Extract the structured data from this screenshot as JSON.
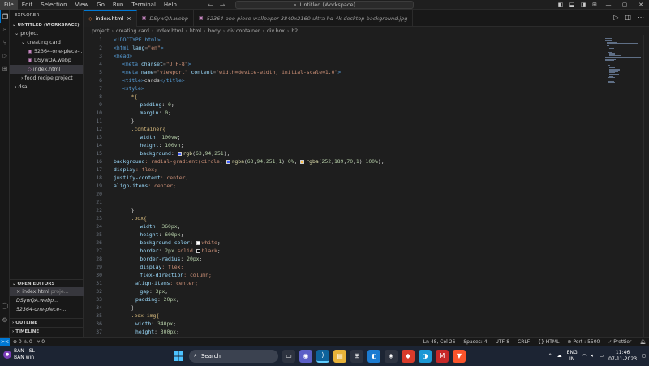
{
  "menu": {
    "items": [
      "File",
      "Edit",
      "Selection",
      "View",
      "Go",
      "Run",
      "Terminal",
      "Help"
    ],
    "active": "File"
  },
  "command_center": {
    "label": "Untitled (Workspace)"
  },
  "explorer": {
    "header": "EXPLORER",
    "workspace": "UNTITLED (WORKSPACE)",
    "tree": [
      {
        "label": "project",
        "arrow": "⌄",
        "indent": 6,
        "selected": false
      },
      {
        "label": "creating card",
        "arrow": "⌄",
        "indent": 14,
        "selected": false
      },
      {
        "label": "52364-one-piece-...",
        "arrow": "",
        "indent": 22,
        "icon": "▣",
        "selected": false
      },
      {
        "label": "DSywQA.webp",
        "arrow": "",
        "indent": 22,
        "icon": "▣",
        "selected": false
      },
      {
        "label": "index.html",
        "arrow": "",
        "indent": 22,
        "icon": "◇",
        "selected": true
      },
      {
        "label": "food recipe project",
        "arrow": "›",
        "indent": 14,
        "selected": false
      },
      {
        "label": "dsa",
        "arrow": "›",
        "indent": 6,
        "selected": false
      }
    ],
    "open_editors_header": "OPEN EDITORS",
    "open_editors": [
      {
        "label": "index.html",
        "desc": "proje...",
        "selected": true,
        "close": "×"
      },
      {
        "label": "DSywQA.webp...",
        "desc": "",
        "selected": false,
        "close": ""
      },
      {
        "label": "52364-one-piece-...",
        "desc": "",
        "selected": false,
        "close": ""
      }
    ],
    "outline": "OUTLINE",
    "timeline": "TIMELINE"
  },
  "tabs": [
    {
      "label": "index.html",
      "icon": "◇",
      "active": true,
      "close": "×"
    },
    {
      "label": "DSywQA.webp",
      "icon": "▣",
      "active": false,
      "close": ""
    },
    {
      "label": "52364-one-piece-wallpaper-3840x2160-ultra-hd-4k-desktop-background.jpg",
      "icon": "▣",
      "active": false,
      "close": ""
    }
  ],
  "breadcrumb": [
    "project",
    "creating card",
    "index.html",
    "html",
    "body",
    "div.container",
    "div.box",
    "h2"
  ],
  "code": {
    "current_line": 48,
    "lines": [
      {
        "n": 1,
        "i": 0,
        "t": [
          [
            "<!DOCTYPE html>",
            "tag"
          ]
        ]
      },
      {
        "n": 2,
        "i": 0,
        "t": [
          [
            "<html ",
            "tag"
          ],
          [
            "lang",
            "attr"
          ],
          [
            "=",
            "punct"
          ],
          [
            "\"en\"",
            "str"
          ],
          [
            ">",
            "tag"
          ]
        ]
      },
      {
        "n": 3,
        "i": 0,
        "t": [
          [
            "<head>",
            "tag"
          ]
        ]
      },
      {
        "n": 4,
        "i": 2,
        "t": [
          [
            "<meta ",
            "tag"
          ],
          [
            "charset",
            "attr"
          ],
          [
            "=",
            "punct"
          ],
          [
            "\"UTF-8\"",
            "str"
          ],
          [
            ">",
            "tag"
          ]
        ]
      },
      {
        "n": 5,
        "i": 2,
        "t": [
          [
            "<meta ",
            "tag"
          ],
          [
            "name",
            "attr"
          ],
          [
            "=",
            "punct"
          ],
          [
            "\"viewport\" ",
            "str"
          ],
          [
            "content",
            "attr"
          ],
          [
            "=",
            "punct"
          ],
          [
            "\"width=device-width, initial-scale=1.0\"",
            "str"
          ],
          [
            ">",
            "tag"
          ]
        ]
      },
      {
        "n": 6,
        "i": 2,
        "t": [
          [
            "<title>",
            "tag"
          ],
          [
            "cards",
            "text"
          ],
          [
            "</title>",
            "tag"
          ]
        ]
      },
      {
        "n": 7,
        "i": 2,
        "t": [
          [
            "<style>",
            "tag"
          ]
        ]
      },
      {
        "n": 8,
        "i": 4,
        "t": [
          [
            "*{",
            "sel"
          ]
        ]
      },
      {
        "n": 9,
        "i": 6,
        "t": [
          [
            "padding",
            "prop"
          ],
          [
            ": ",
            "text"
          ],
          [
            "0",
            "num"
          ],
          [
            ";",
            "text"
          ]
        ]
      },
      {
        "n": 10,
        "i": 6,
        "t": [
          [
            "margin",
            "prop"
          ],
          [
            ": ",
            "text"
          ],
          [
            "0",
            "num"
          ],
          [
            ";",
            "text"
          ]
        ]
      },
      {
        "n": 11,
        "i": 4,
        "t": [
          [
            "}",
            "text"
          ]
        ]
      },
      {
        "n": 12,
        "i": 4,
        "t": [
          [
            ".container{",
            "sel"
          ]
        ]
      },
      {
        "n": 13,
        "i": 6,
        "t": [
          [
            "width",
            "prop"
          ],
          [
            ": ",
            "text"
          ],
          [
            "100vw",
            "num"
          ],
          [
            ";",
            "text"
          ]
        ]
      },
      {
        "n": 14,
        "i": 6,
        "t": [
          [
            "height",
            "prop"
          ],
          [
            ": ",
            "text"
          ],
          [
            "100vh",
            "num"
          ],
          [
            ";",
            "text"
          ]
        ]
      },
      {
        "n": 15,
        "i": 6,
        "t": [
          [
            "background",
            "prop"
          ],
          [
            ": ",
            "text"
          ],
          [
            "SW1",
            "swatch"
          ],
          [
            "rgb",
            "fn"
          ],
          [
            "(",
            "text"
          ],
          [
            "63",
            "num"
          ],
          [
            ",",
            "text"
          ],
          [
            "94",
            "num"
          ],
          [
            ",",
            "text"
          ],
          [
            "251",
            "num"
          ],
          [
            ");",
            "text"
          ]
        ]
      },
      {
        "n": 16,
        "i": 0,
        "t": [
          [
            "background",
            "prop"
          ],
          [
            ": radial-gradient(circle, ",
            "val"
          ],
          [
            "SW1",
            "swatch"
          ],
          [
            "rgba",
            "fn"
          ],
          [
            "(",
            "text"
          ],
          [
            "63",
            "num"
          ],
          [
            ",",
            "text"
          ],
          [
            "94",
            "num"
          ],
          [
            ",",
            "text"
          ],
          [
            "251",
            "num"
          ],
          [
            ",",
            "text"
          ],
          [
            "1",
            "num"
          ],
          [
            ") ",
            "text"
          ],
          [
            "0%",
            "num"
          ],
          [
            ", ",
            "text"
          ],
          [
            "SW2",
            "swatch"
          ],
          [
            "rgba",
            "fn"
          ],
          [
            "(",
            "text"
          ],
          [
            "252",
            "num"
          ],
          [
            ",",
            "text"
          ],
          [
            "189",
            "num"
          ],
          [
            ",",
            "text"
          ],
          [
            "70",
            "num"
          ],
          [
            ",",
            "text"
          ],
          [
            "1",
            "num"
          ],
          [
            ") ",
            "text"
          ],
          [
            "100%",
            "num"
          ],
          [
            ");",
            "text"
          ]
        ]
      },
      {
        "n": 17,
        "i": 0,
        "t": [
          [
            "display",
            "prop"
          ],
          [
            ": flex;",
            "val"
          ]
        ]
      },
      {
        "n": 18,
        "i": 0,
        "t": [
          [
            "justify-content",
            "prop"
          ],
          [
            ": center;",
            "val"
          ]
        ]
      },
      {
        "n": 19,
        "i": 0,
        "t": [
          [
            "align-items",
            "prop"
          ],
          [
            ": center;",
            "val"
          ]
        ]
      },
      {
        "n": 20,
        "i": 0,
        "t": []
      },
      {
        "n": 21,
        "i": 0,
        "t": []
      },
      {
        "n": 22,
        "i": 4,
        "t": [
          [
            "}",
            "text"
          ]
        ]
      },
      {
        "n": 23,
        "i": 4,
        "t": [
          [
            ".box{",
            "sel"
          ]
        ]
      },
      {
        "n": 24,
        "i": 6,
        "t": [
          [
            "width",
            "prop"
          ],
          [
            ": ",
            "text"
          ],
          [
            "360px",
            "num"
          ],
          [
            ";",
            "text"
          ]
        ]
      },
      {
        "n": 25,
        "i": 6,
        "t": [
          [
            "height",
            "prop"
          ],
          [
            ": ",
            "text"
          ],
          [
            "600px",
            "num"
          ],
          [
            ";",
            "text"
          ]
        ]
      },
      {
        "n": 26,
        "i": 6,
        "t": [
          [
            "background-color",
            "prop"
          ],
          [
            ": ",
            "text"
          ],
          [
            "SW3",
            "swatch"
          ],
          [
            "white",
            "val"
          ],
          [
            ";",
            "text"
          ]
        ]
      },
      {
        "n": 27,
        "i": 6,
        "t": [
          [
            "border",
            "prop"
          ],
          [
            ": ",
            "text"
          ],
          [
            "2px",
            "num"
          ],
          [
            " solid ",
            "val"
          ],
          [
            "SW4",
            "swatch"
          ],
          [
            "black",
            "val"
          ],
          [
            ";",
            "text"
          ]
        ]
      },
      {
        "n": 28,
        "i": 6,
        "t": [
          [
            "border-radius",
            "prop"
          ],
          [
            ": ",
            "text"
          ],
          [
            "20px",
            "num"
          ],
          [
            ";",
            "text"
          ]
        ]
      },
      {
        "n": 29,
        "i": 6,
        "t": [
          [
            "display",
            "prop"
          ],
          [
            ": flex;",
            "val"
          ]
        ]
      },
      {
        "n": 30,
        "i": 6,
        "t": [
          [
            "flex-direction",
            "prop"
          ],
          [
            ": column;",
            "val"
          ]
        ]
      },
      {
        "n": 31,
        "i": 5,
        "t": [
          [
            "align-items",
            "prop"
          ],
          [
            ": center;",
            "val"
          ]
        ]
      },
      {
        "n": 32,
        "i": 6,
        "t": [
          [
            "gap",
            "prop"
          ],
          [
            ": ",
            "text"
          ],
          [
            "3px",
            "num"
          ],
          [
            ";",
            "text"
          ]
        ]
      },
      {
        "n": 33,
        "i": 5,
        "t": [
          [
            "padding",
            "prop"
          ],
          [
            ": ",
            "text"
          ],
          [
            "20px",
            "num"
          ],
          [
            ";",
            "text"
          ]
        ]
      },
      {
        "n": 34,
        "i": 4,
        "t": [
          [
            "}",
            "text"
          ]
        ]
      },
      {
        "n": 35,
        "i": 4,
        "t": [
          [
            ".box img{",
            "sel"
          ]
        ]
      },
      {
        "n": 36,
        "i": 5,
        "t": [
          [
            "width",
            "prop"
          ],
          [
            ": ",
            "text"
          ],
          [
            "340px",
            "num"
          ],
          [
            ";",
            "text"
          ]
        ]
      },
      {
        "n": 37,
        "i": 5,
        "t": [
          [
            "height",
            "prop"
          ],
          [
            ": ",
            "text"
          ],
          [
            "300px",
            "num"
          ],
          [
            ";",
            "text"
          ]
        ]
      }
    ],
    "swatches": {
      "SW1": "#3f5efb",
      "SW2": "#fcbd46",
      "SW3": "#ffffff",
      "SW4": "#000000"
    }
  },
  "status": {
    "remote_icon": "><",
    "problems": "⊗ 0 ⚠ 0",
    "ports_fwd": "⑂ 0",
    "position": "Ln 48, Col 26",
    "spaces": "Spaces: 4",
    "encoding": "UTF-8",
    "eol": "CRLF",
    "language": "{} HTML",
    "port": "⊘ Port : 5500",
    "prettier": "✓ Prettier"
  },
  "taskbar": {
    "weather_title": "BAN - SL",
    "weather_sub": "BAN win",
    "search_label": "Search",
    "lang_top": "ENG",
    "lang_bottom": "IN",
    "time": "11:46",
    "date": "07-11-2023"
  },
  "colors": {
    "accent": "#0078d4",
    "status_bg": "#181818",
    "editor_bg": "#1e1e1e"
  }
}
